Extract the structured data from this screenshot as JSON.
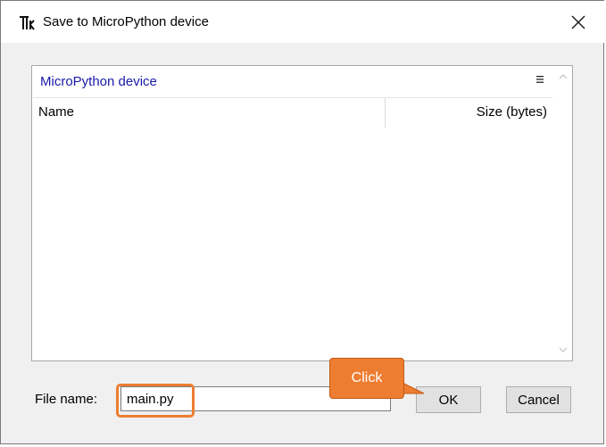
{
  "window": {
    "title": "Save to MicroPython device"
  },
  "browser": {
    "location": "MicroPython device",
    "columns": {
      "name": "Name",
      "size": "Size (bytes)"
    },
    "menu_icon": "hamburger-menu-icon"
  },
  "form": {
    "file_label": "File name:",
    "file_value": "main.py"
  },
  "buttons": {
    "ok": "OK",
    "cancel": "Cancel"
  },
  "annotation": {
    "callout_text": "Click",
    "accent_color": "#ed7d31"
  }
}
